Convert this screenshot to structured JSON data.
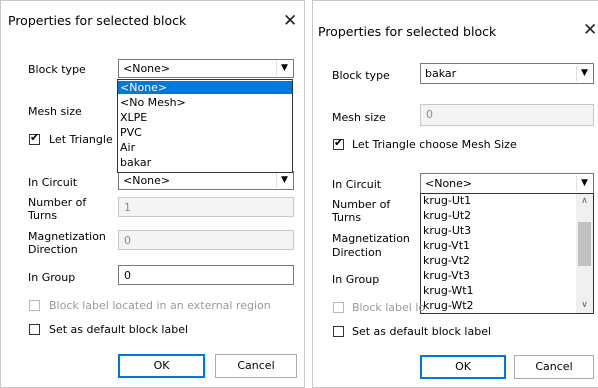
{
  "left_dialog": {
    "title": "Properties for selected block",
    "close_glyph": "✕",
    "block_type_label": "Block type",
    "block_type_value": "<None>",
    "dropdown_options": [
      "<None>",
      "<No Mesh>",
      "XLPE",
      "PVC",
      "Air",
      "bakar"
    ],
    "mesh_size_label": "Mesh size",
    "let_triangle_label": "Let Triangle",
    "in_circuit_label": "In Circuit",
    "in_circuit_value": "<None>",
    "number_of_turns_label": [
      "Number of",
      "Turns"
    ],
    "number_of_turns_value": "1",
    "magnetization_label": [
      "Magnetization",
      "Direction"
    ],
    "magnetization_value": "0",
    "in_group_label": "In Group",
    "in_group_value": "0",
    "external_region_label": "Block label located in an external region",
    "default_label": "Set as default block label",
    "ok_label": "OK",
    "cancel_label": "Cancel"
  },
  "right_dialog": {
    "title": "Properties for selected block",
    "close_glyph": "✕",
    "block_type_label": "Block type",
    "block_type_value": "bakar",
    "mesh_size_label": "Mesh size",
    "mesh_size_value": "0",
    "let_triangle_label": "Let Triangle choose Mesh Size",
    "in_circuit_label": "In Circuit",
    "in_circuit_value": "<None>",
    "number_of_turns_label": [
      "Number of",
      "Turns"
    ],
    "magnetization_label": [
      "Magnetization",
      "Direction"
    ],
    "in_group_label": "In Group",
    "circuit_options": [
      "krug-Ut1",
      "krug-Ut2",
      "krug-Ut3",
      "krug-Vt1",
      "krug-Vt2",
      "krug-Vt3",
      "krug-Wt1",
      "krug-Wt2"
    ],
    "external_region_label": "Block label lo",
    "default_label": "Set as default block label",
    "ok_label": "OK",
    "cancel_label": "Cancel"
  },
  "icons": {
    "dropdown_arrow": "▼",
    "scroll_up": "∧",
    "scroll_down": "∨",
    "check": "✔"
  },
  "colors": {
    "selection": "#0078d7",
    "default_button_border": "#0078d7"
  }
}
